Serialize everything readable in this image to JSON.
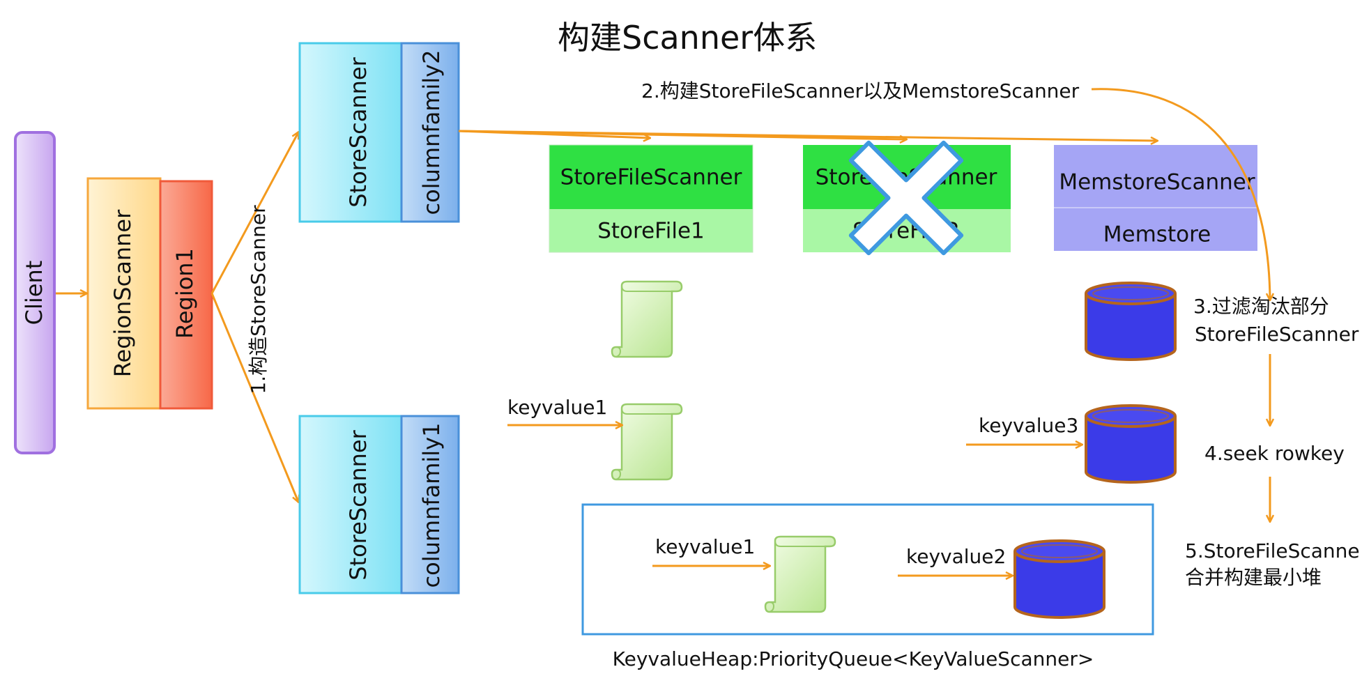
{
  "title": "构建Scanner体系",
  "client": {
    "label": "Client"
  },
  "region_scanner": {
    "label": "RegionScanner"
  },
  "region": {
    "label": "Region1"
  },
  "step1": {
    "label": "1.构造StoreScanner"
  },
  "store_scanner_top": {
    "label": "StoreScanner",
    "family": "columnfamily2"
  },
  "store_scanner_bottom": {
    "label": "StoreScanner",
    "family": "columnfamily1"
  },
  "step2": {
    "label": "2.构建StoreFileScanner以及MemstoreScanner"
  },
  "storefile_scanner_1": {
    "scanner": "StoreFileScanner",
    "file": "StoreFile1"
  },
  "storefile_scanner_2": {
    "scanner": "StoreFileScanner",
    "file": "StoreFile2",
    "status": "filtered-out"
  },
  "memstore_scanner": {
    "scanner": "MemstoreScanner",
    "store": "Memstore"
  },
  "step3": {
    "line1": "3.过滤淘汰部分",
    "line2": "StoreFileScanner"
  },
  "step4": {
    "label": "4.seek rowkey"
  },
  "step5": {
    "line1": "5.StoreFileScanne",
    "line2": "合并构建最小堆"
  },
  "keyvalues": {
    "kv1_outer": "keyvalue1",
    "kv3": "keyvalue3",
    "kv1_heap": "keyvalue1",
    "kv2_heap": "keyvalue2"
  },
  "heap": {
    "caption": "KeyvalueHeap:PriorityQueue<KeyValueScanner>"
  },
  "colors": {
    "arrow": "#f39a1e",
    "client_fill": "#dcc8f5",
    "region_scanner_fill": "#ffe6b0",
    "region_fill": "#f9836b",
    "store_scanner_fill": "#a8ecf8",
    "family_fill": "#9cc6f2",
    "scanner_green": "#2fe043",
    "file_green": "#a9f7a5",
    "memstore": "#a5a5f5",
    "cylinder": "#3b3be8",
    "cylinder_rim": "#b5651d",
    "heap_border": "#3f99e0",
    "cross_border": "#3f99e0"
  }
}
